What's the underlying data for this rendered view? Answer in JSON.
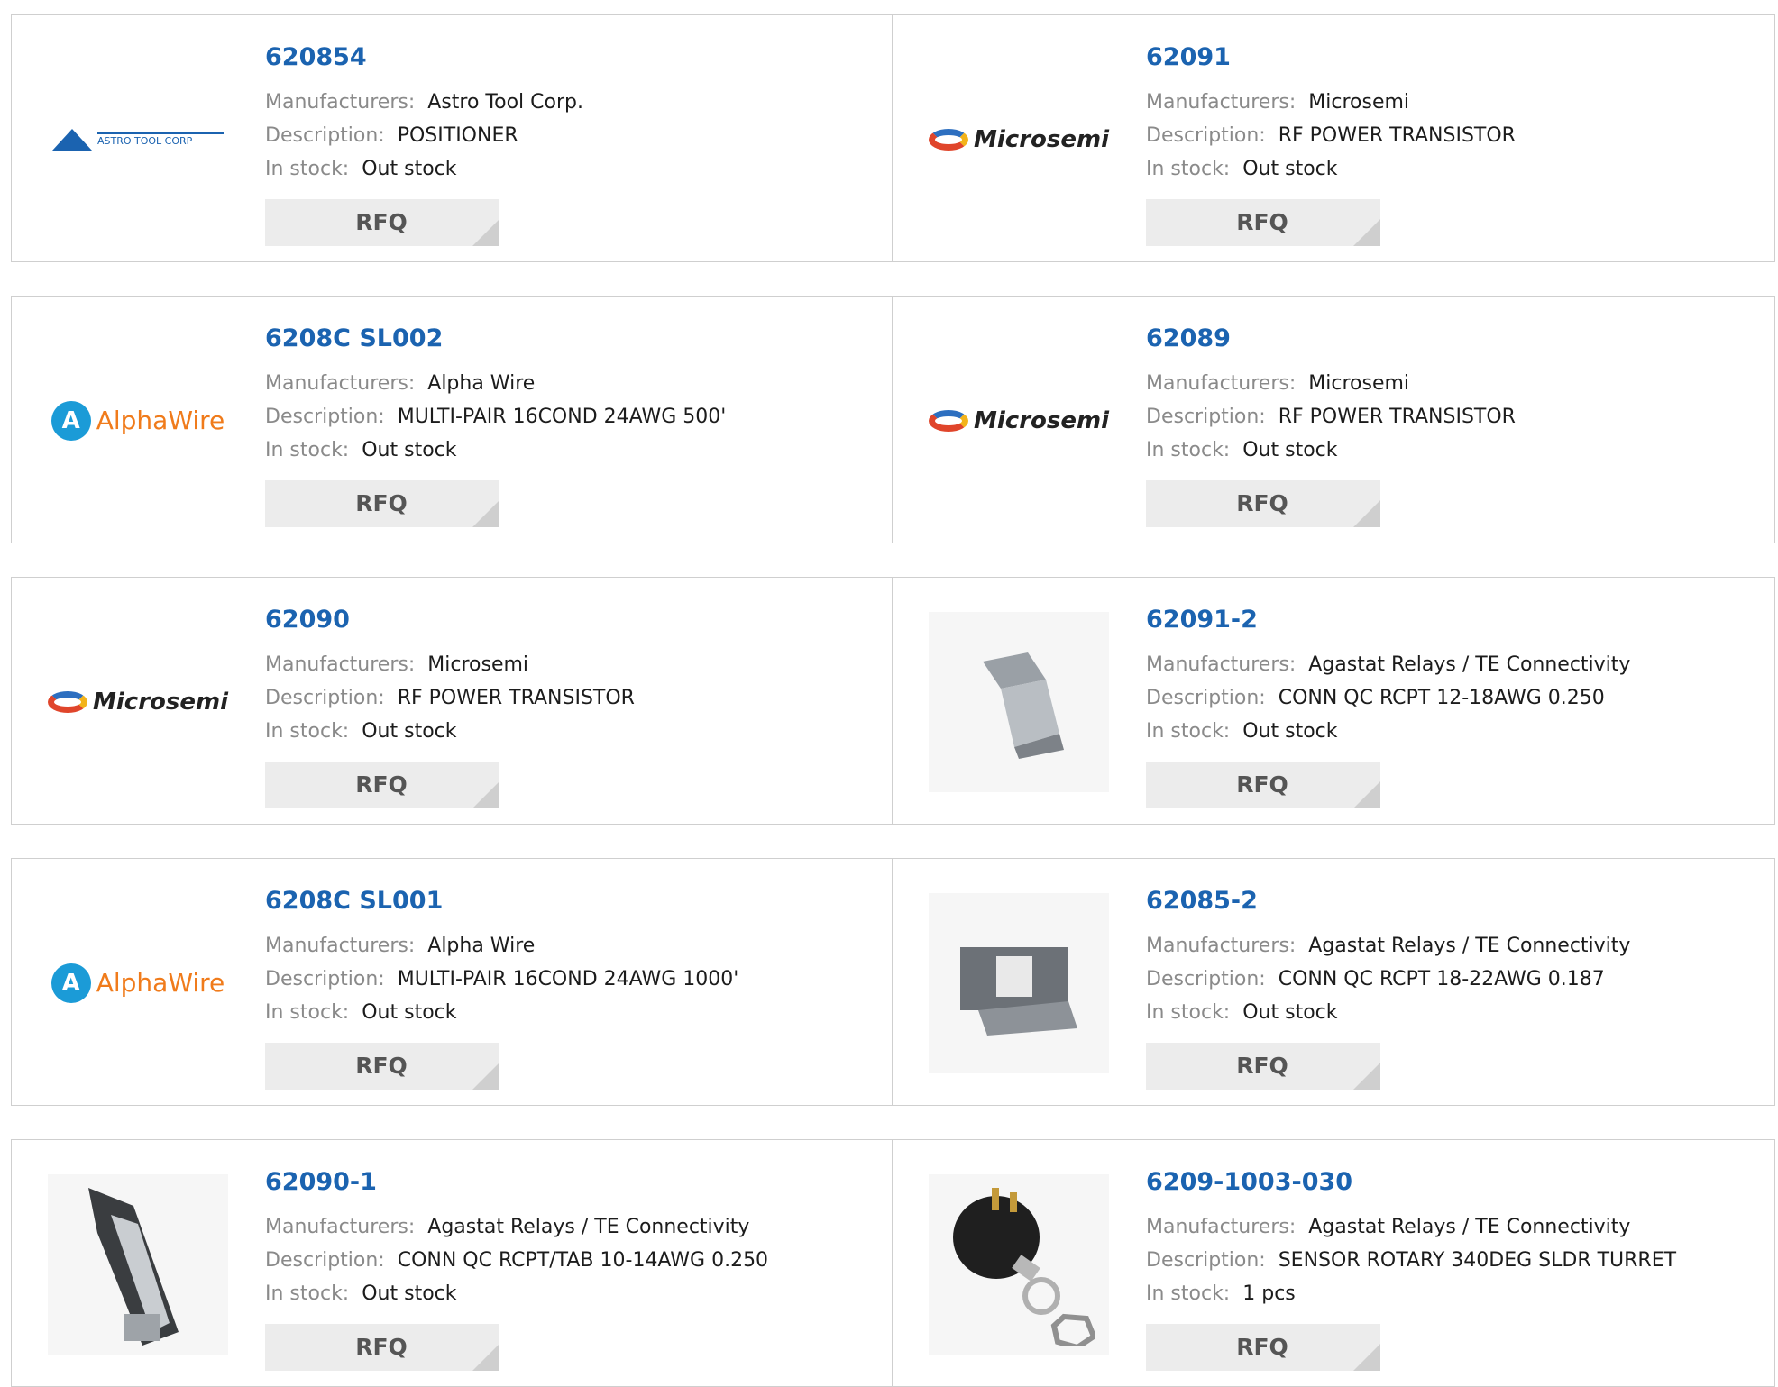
{
  "labels": {
    "manufacturer": "Manufacturers:",
    "description": "Description:",
    "stock": "In stock:",
    "rfq": "RFQ"
  },
  "products": [
    {
      "part": "620854",
      "manufacturer": "Astro Tool Corp.",
      "description": "POSITIONER",
      "stock": "Out stock",
      "logo": "astro-tool-logo",
      "logo_text": "ASTRO TOOL CORP"
    },
    {
      "part": "62091",
      "manufacturer": "Microsemi",
      "description": "RF POWER TRANSISTOR",
      "stock": "Out stock",
      "logo": "microsemi-logo",
      "logo_text": "Microsemi"
    },
    {
      "part": "6208C SL002",
      "manufacturer": "Alpha Wire",
      "description": "MULTI-PAIR 16COND 24AWG 500'",
      "stock": "Out stock",
      "logo": "alphawire-logo",
      "logo_text": "AlphaWire"
    },
    {
      "part": "62089",
      "manufacturer": "Microsemi",
      "description": "RF POWER TRANSISTOR",
      "stock": "Out stock",
      "logo": "microsemi-logo",
      "logo_text": "Microsemi"
    },
    {
      "part": "62090",
      "manufacturer": "Microsemi",
      "description": "RF POWER TRANSISTOR",
      "stock": "Out stock",
      "logo": "microsemi-logo",
      "logo_text": "Microsemi"
    },
    {
      "part": "62091-2",
      "manufacturer": "Agastat Relays / TE Connectivity",
      "description": "CONN QC RCPT 12-18AWG 0.250",
      "stock": "Out stock",
      "logo": "connector-photo"
    },
    {
      "part": "6208C SL001",
      "manufacturer": "Alpha Wire",
      "description": "MULTI-PAIR 16COND 24AWG 1000'",
      "stock": "Out stock",
      "logo": "alphawire-logo",
      "logo_text": "AlphaWire"
    },
    {
      "part": "62085-2",
      "manufacturer": "Agastat Relays / TE Connectivity",
      "description": "CONN QC RCPT 18-22AWG 0.187",
      "stock": "Out stock",
      "logo": "connector-photo"
    },
    {
      "part": "62090-1",
      "manufacturer": "Agastat Relays / TE Connectivity",
      "description": "CONN QC RCPT/TAB 10-14AWG 0.250",
      "stock": "Out stock",
      "logo": "connector-photo"
    },
    {
      "part": "6209-1003-030",
      "manufacturer": "Agastat Relays / TE Connectivity",
      "description": "SENSOR ROTARY 340DEG SLDR TURRET",
      "stock": "1 pcs",
      "logo": "rotary-sensor-photo"
    }
  ]
}
